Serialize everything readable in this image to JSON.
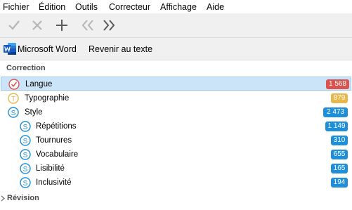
{
  "menu": {
    "items": [
      "Fichier",
      "Édition",
      "Outils",
      "Correcteur",
      "Affichage",
      "Aide"
    ]
  },
  "toolbar": {
    "icons": [
      "checkmark-icon",
      "cross-icon",
      "plus-icon",
      "double-chevron-left-icon",
      "double-chevron-right-icon"
    ]
  },
  "wordbar": {
    "app_label": "Microsoft Word",
    "revert_label": "Revenir au texte"
  },
  "correction": {
    "header": "Correction",
    "rows": [
      {
        "label": "Langue",
        "count": "1 568",
        "color": "#d9534f",
        "icon": "error-check-icon"
      },
      {
        "label": "Typographie",
        "count": "879",
        "color": "#e8b84a",
        "icon": "typography-t-icon"
      },
      {
        "label": "Style",
        "count": "2 473",
        "color": "#1e8fd8",
        "icon": "style-s-icon"
      },
      {
        "label": "Répétitions",
        "count": "1 149",
        "color": "#1e8fd8",
        "icon": "style-s-icon"
      },
      {
        "label": "Tournures",
        "count": "310",
        "color": "#1e8fd8",
        "icon": "style-s-icon"
      },
      {
        "label": "Vocabulaire",
        "count": "655",
        "color": "#1e8fd8",
        "icon": "style-s-icon"
      },
      {
        "label": "Lisibilité",
        "count": "165",
        "color": "#1e8fd8",
        "icon": "style-s-icon"
      },
      {
        "label": "Inclusivité",
        "count": "194",
        "color": "#1e8fd8",
        "icon": "style-s-icon"
      }
    ]
  },
  "revision": {
    "header": "Révision"
  },
  "colors": {
    "langue": "#d9534f",
    "typographie": "#e8b84a",
    "style": "#1e8fd8",
    "selection": "#cce4f7"
  }
}
